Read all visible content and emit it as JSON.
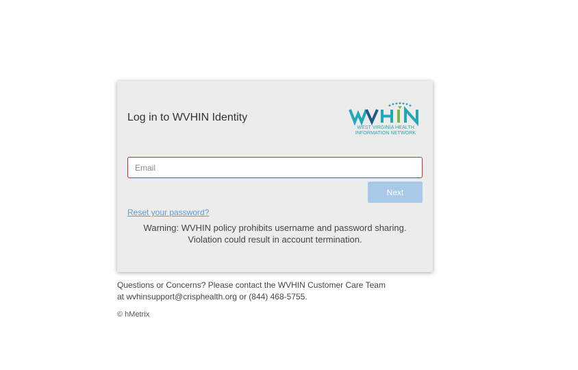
{
  "login": {
    "title": "Log in to WVHIN Identity",
    "email_placeholder": "Email",
    "email_value": "",
    "next_label": "Next",
    "reset_label": "Reset your password?",
    "warning_line1": "Warning: WVHIN policy prohibits username and password sharing.",
    "warning_line2": "Violation could result in account termination."
  },
  "logo": {
    "wordmark": "WVHIN",
    "line1": "WEST VIRGINIA HEALTH",
    "line2": "INFORMATION NETWORK",
    "colors": {
      "teal": "#20a9b5",
      "green": "#7ab648",
      "navy": "#1f5a8a"
    }
  },
  "footer": {
    "contact_line1": "Questions or Concerns? Please contact the WVHIN Customer Care Team",
    "contact_line2": "at wvhinsupport@crisphealth.org or (844) 468-5755.",
    "copyright": "© hMetrix"
  },
  "colors": {
    "card_bg": "#ececec",
    "input_border_error": "#c9302c",
    "button_disabled": "#a9c9e8",
    "link": "#5b9bd5"
  }
}
